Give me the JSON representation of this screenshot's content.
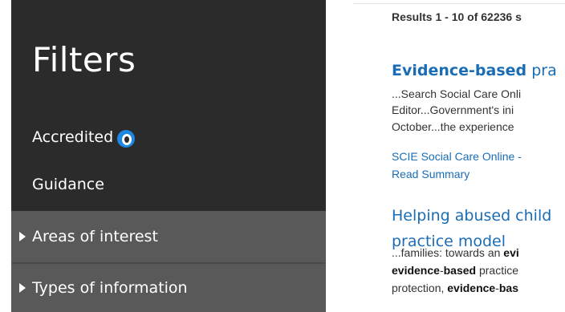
{
  "sidebar": {
    "title": "Filters",
    "links": {
      "accredited": "Accredited",
      "guidance": "Guidance"
    },
    "collapsibles": {
      "areas": "Areas of interest",
      "types": "Types of information"
    }
  },
  "results": {
    "count_text": "Results 1 - 10 of 62236 s",
    "items": [
      {
        "title_bold": "Evidence-based",
        "title_rest": " pra",
        "snippet_lines": [
          "...Search Social Care Onli",
          "Editor...Government's ini",
          "October...the experience"
        ],
        "source": "SCIE Social Care Online -",
        "read_summary": "Read Summary"
      },
      {
        "title_line1": "Helping abused child",
        "title_line2": "practice model",
        "snippet": {
          "line1_pre": "...families: towards an ",
          "line1_bold": "evi",
          "line2_bold": "evidence",
          "line2_mid": "-",
          "line2_bold2": "based",
          "line2_post": " practice",
          "line3_pre": "protection, ",
          "line3_bold": "evidence",
          "line3_mid": "-",
          "line3_bold2": "bas"
        }
      }
    ]
  }
}
